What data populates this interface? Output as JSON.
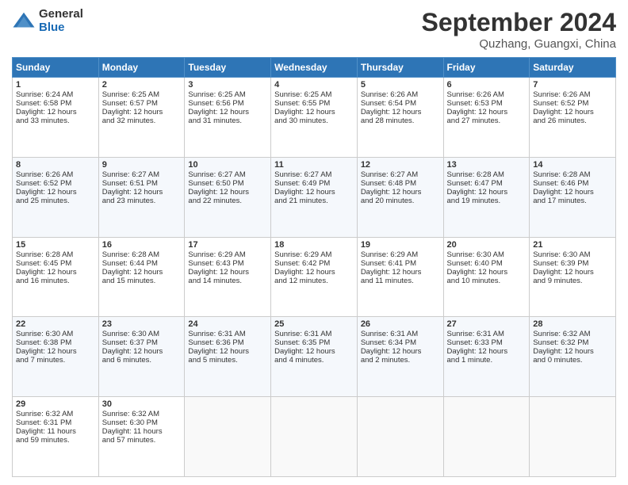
{
  "header": {
    "logo_general": "General",
    "logo_blue": "Blue",
    "month_title": "September 2024",
    "location": "Quzhang, Guangxi, China"
  },
  "days_of_week": [
    "Sunday",
    "Monday",
    "Tuesday",
    "Wednesday",
    "Thursday",
    "Friday",
    "Saturday"
  ],
  "weeks": [
    [
      {
        "day": "1",
        "info": "Sunrise: 6:24 AM\nSunset: 6:58 PM\nDaylight: 12 hours\nand 33 minutes."
      },
      {
        "day": "2",
        "info": "Sunrise: 6:25 AM\nSunset: 6:57 PM\nDaylight: 12 hours\nand 32 minutes."
      },
      {
        "day": "3",
        "info": "Sunrise: 6:25 AM\nSunset: 6:56 PM\nDaylight: 12 hours\nand 31 minutes."
      },
      {
        "day": "4",
        "info": "Sunrise: 6:25 AM\nSunset: 6:55 PM\nDaylight: 12 hours\nand 30 minutes."
      },
      {
        "day": "5",
        "info": "Sunrise: 6:26 AM\nSunset: 6:54 PM\nDaylight: 12 hours\nand 28 minutes."
      },
      {
        "day": "6",
        "info": "Sunrise: 6:26 AM\nSunset: 6:53 PM\nDaylight: 12 hours\nand 27 minutes."
      },
      {
        "day": "7",
        "info": "Sunrise: 6:26 AM\nSunset: 6:52 PM\nDaylight: 12 hours\nand 26 minutes."
      }
    ],
    [
      {
        "day": "8",
        "info": "Sunrise: 6:26 AM\nSunset: 6:52 PM\nDaylight: 12 hours\nand 25 minutes."
      },
      {
        "day": "9",
        "info": "Sunrise: 6:27 AM\nSunset: 6:51 PM\nDaylight: 12 hours\nand 23 minutes."
      },
      {
        "day": "10",
        "info": "Sunrise: 6:27 AM\nSunset: 6:50 PM\nDaylight: 12 hours\nand 22 minutes."
      },
      {
        "day": "11",
        "info": "Sunrise: 6:27 AM\nSunset: 6:49 PM\nDaylight: 12 hours\nand 21 minutes."
      },
      {
        "day": "12",
        "info": "Sunrise: 6:27 AM\nSunset: 6:48 PM\nDaylight: 12 hours\nand 20 minutes."
      },
      {
        "day": "13",
        "info": "Sunrise: 6:28 AM\nSunset: 6:47 PM\nDaylight: 12 hours\nand 19 minutes."
      },
      {
        "day": "14",
        "info": "Sunrise: 6:28 AM\nSunset: 6:46 PM\nDaylight: 12 hours\nand 17 minutes."
      }
    ],
    [
      {
        "day": "15",
        "info": "Sunrise: 6:28 AM\nSunset: 6:45 PM\nDaylight: 12 hours\nand 16 minutes."
      },
      {
        "day": "16",
        "info": "Sunrise: 6:28 AM\nSunset: 6:44 PM\nDaylight: 12 hours\nand 15 minutes."
      },
      {
        "day": "17",
        "info": "Sunrise: 6:29 AM\nSunset: 6:43 PM\nDaylight: 12 hours\nand 14 minutes."
      },
      {
        "day": "18",
        "info": "Sunrise: 6:29 AM\nSunset: 6:42 PM\nDaylight: 12 hours\nand 12 minutes."
      },
      {
        "day": "19",
        "info": "Sunrise: 6:29 AM\nSunset: 6:41 PM\nDaylight: 12 hours\nand 11 minutes."
      },
      {
        "day": "20",
        "info": "Sunrise: 6:30 AM\nSunset: 6:40 PM\nDaylight: 12 hours\nand 10 minutes."
      },
      {
        "day": "21",
        "info": "Sunrise: 6:30 AM\nSunset: 6:39 PM\nDaylight: 12 hours\nand 9 minutes."
      }
    ],
    [
      {
        "day": "22",
        "info": "Sunrise: 6:30 AM\nSunset: 6:38 PM\nDaylight: 12 hours\nand 7 minutes."
      },
      {
        "day": "23",
        "info": "Sunrise: 6:30 AM\nSunset: 6:37 PM\nDaylight: 12 hours\nand 6 minutes."
      },
      {
        "day": "24",
        "info": "Sunrise: 6:31 AM\nSunset: 6:36 PM\nDaylight: 12 hours\nand 5 minutes."
      },
      {
        "day": "25",
        "info": "Sunrise: 6:31 AM\nSunset: 6:35 PM\nDaylight: 12 hours\nand 4 minutes."
      },
      {
        "day": "26",
        "info": "Sunrise: 6:31 AM\nSunset: 6:34 PM\nDaylight: 12 hours\nand 2 minutes."
      },
      {
        "day": "27",
        "info": "Sunrise: 6:31 AM\nSunset: 6:33 PM\nDaylight: 12 hours\nand 1 minute."
      },
      {
        "day": "28",
        "info": "Sunrise: 6:32 AM\nSunset: 6:32 PM\nDaylight: 12 hours\nand 0 minutes."
      }
    ],
    [
      {
        "day": "29",
        "info": "Sunrise: 6:32 AM\nSunset: 6:31 PM\nDaylight: 11 hours\nand 59 minutes."
      },
      {
        "day": "30",
        "info": "Sunrise: 6:32 AM\nSunset: 6:30 PM\nDaylight: 11 hours\nand 57 minutes."
      },
      {
        "day": "",
        "info": ""
      },
      {
        "day": "",
        "info": ""
      },
      {
        "day": "",
        "info": ""
      },
      {
        "day": "",
        "info": ""
      },
      {
        "day": "",
        "info": ""
      }
    ]
  ]
}
